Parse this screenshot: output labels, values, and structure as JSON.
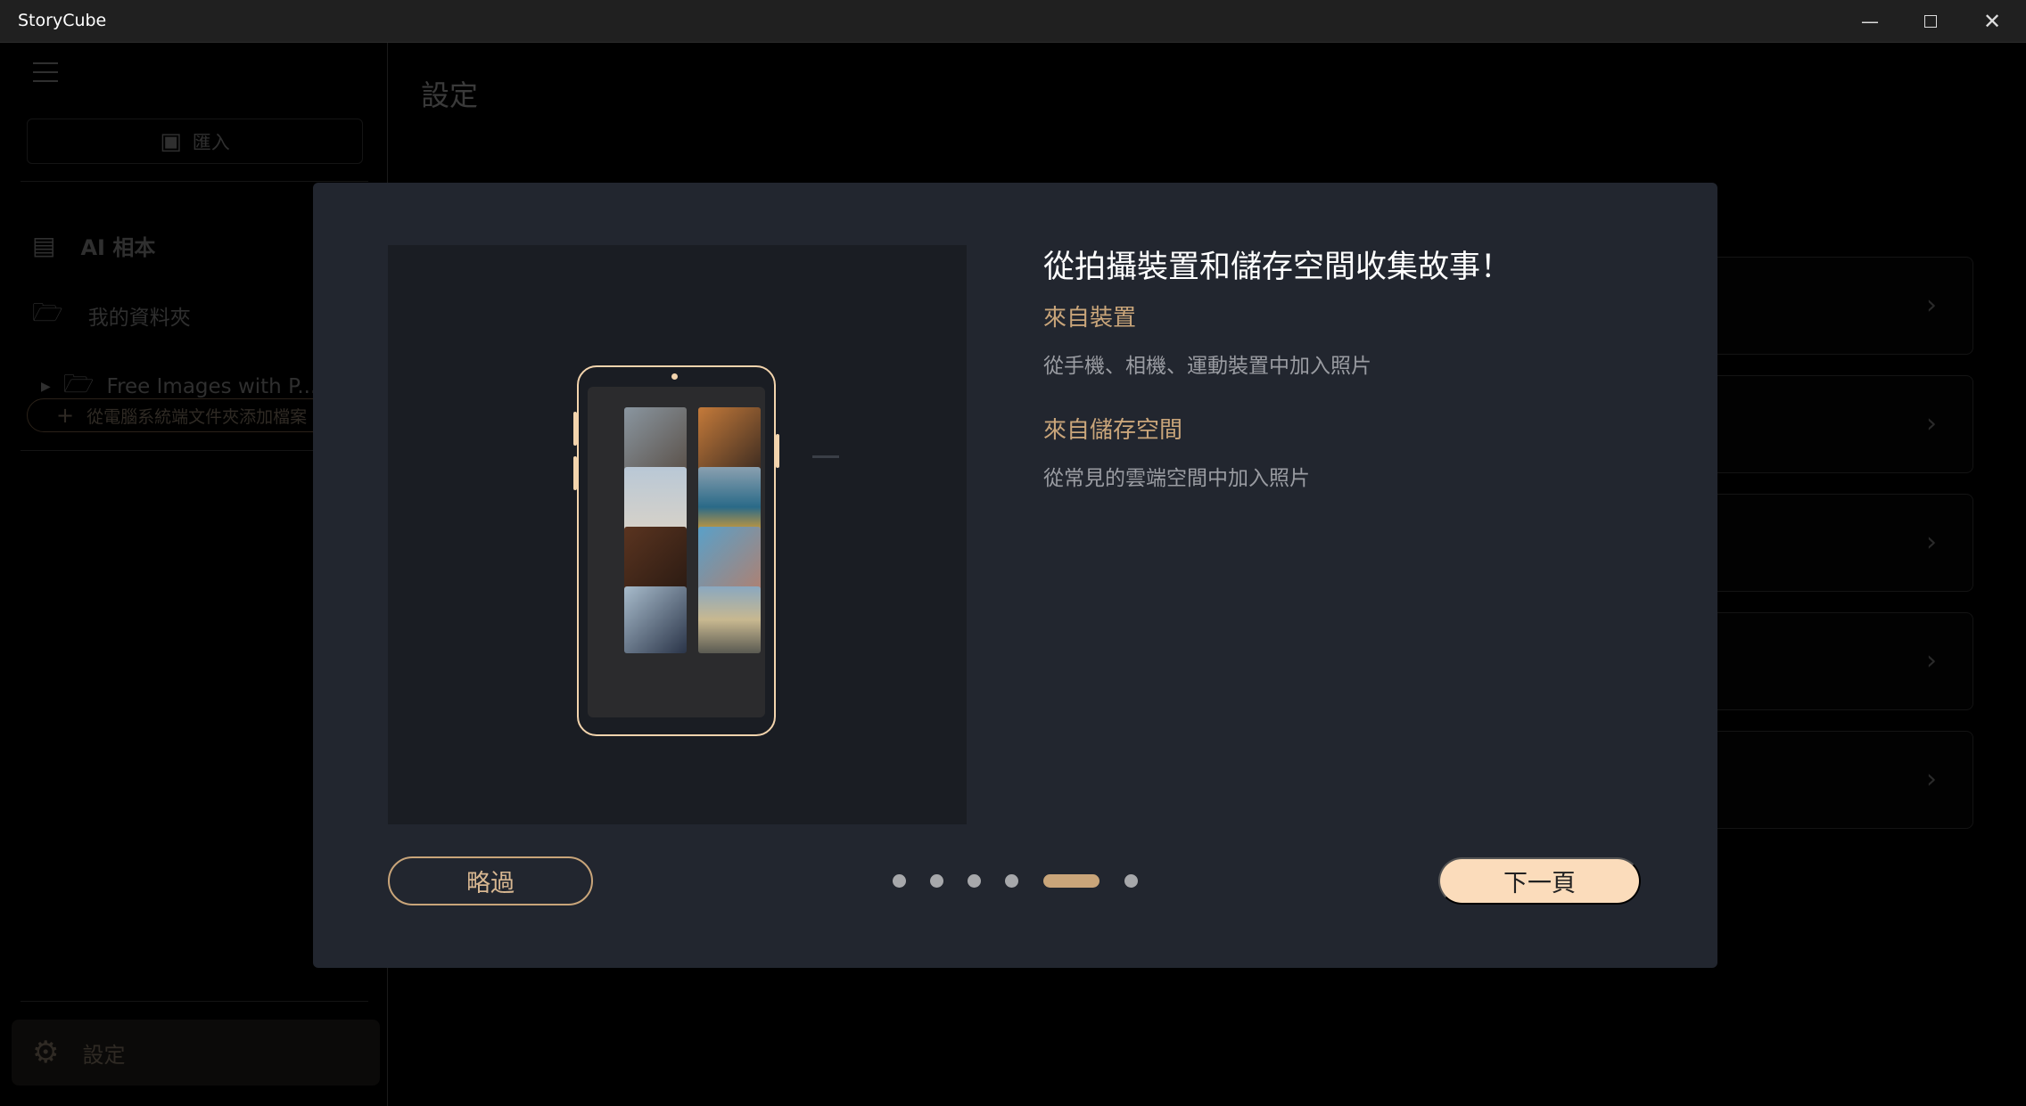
{
  "window": {
    "title": "StoryCube"
  },
  "sidebar": {
    "import_label": "匯入",
    "items": [
      {
        "label": "AI 相本"
      },
      {
        "label": "我的資料夾"
      }
    ],
    "folder": {
      "label": "Free Images with P..."
    },
    "add_folder_label": "從電腦系統端文件夾添加檔案",
    "settings_label": "設定"
  },
  "main": {
    "title": "設定"
  },
  "dialog": {
    "title": "從拍攝裝置和儲存空間收集故事！",
    "sections": [
      {
        "heading": "來自裝置",
        "text": "從手機、相機、運動裝置中加入照片"
      },
      {
        "heading": "來自儲存空間",
        "text": "從常見的雲端空間中加入照片"
      }
    ],
    "skip_label": "略過",
    "next_label": "下一頁",
    "pagination": {
      "total": 6,
      "current": 5
    }
  },
  "colors": {
    "accent": "#c9a57a",
    "next_bg": "#fbdcbb",
    "dialog_bg": "#22262f"
  }
}
